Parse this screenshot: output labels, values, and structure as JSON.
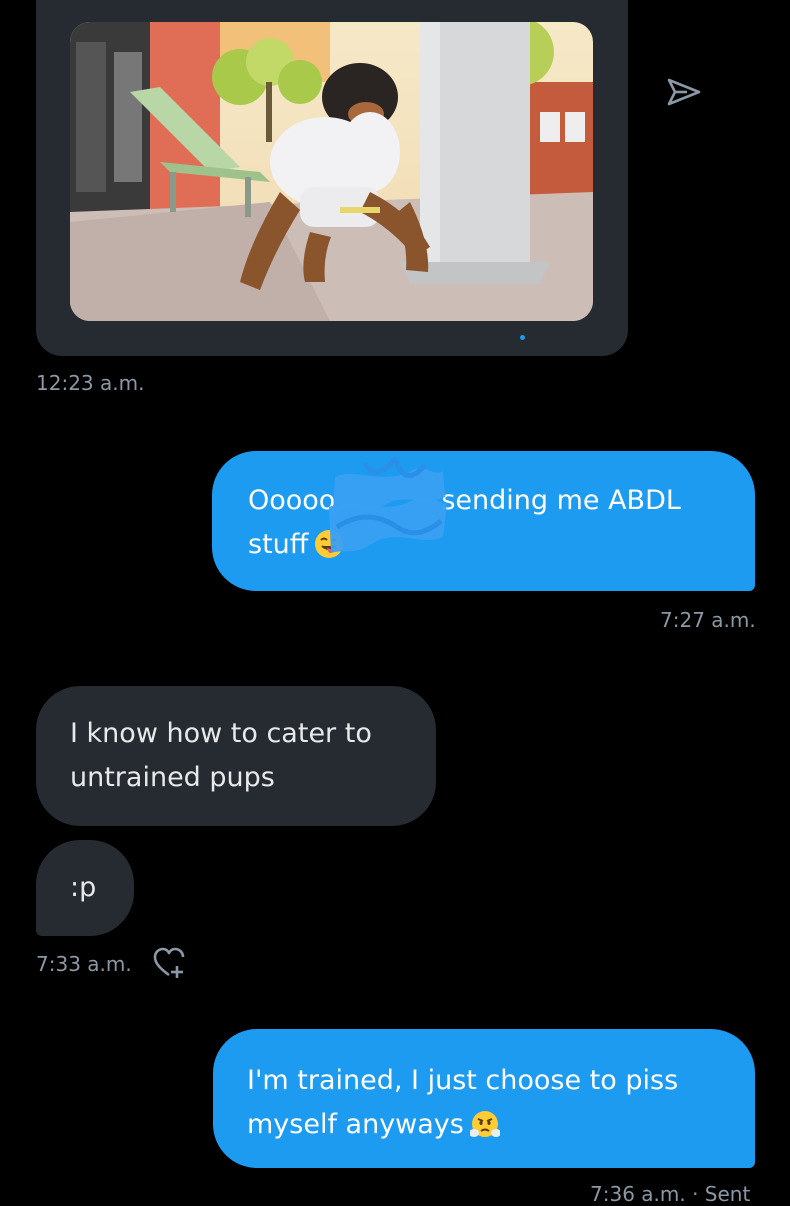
{
  "conversation": {
    "messages": [
      {
        "id": "m1",
        "direction": "received",
        "type": "image",
        "image_description": "cartoon rottweiler character crawling on sidewalk",
        "timestamp": "12:23 a.m."
      },
      {
        "id": "m2",
        "direction": "sent",
        "text_before_redaction": "Ooooo",
        "text_after_redaction": "sending me ABDL",
        "text_line2": "stuff",
        "emoji": "winking-face-with-tongue",
        "timestamp": "7:27 a.m."
      },
      {
        "id": "m3",
        "direction": "received",
        "text": "I know how to cater to untrained pups"
      },
      {
        "id": "m4",
        "direction": "received",
        "text": ":p",
        "timestamp": "7:33 a.m."
      },
      {
        "id": "m5",
        "direction": "sent",
        "text": "I'm trained, I just choose to piss myself anyways",
        "emoji": "face-with-steam-from-nose",
        "timestamp": "7:36 a.m. · Sent"
      }
    ]
  },
  "icons": {
    "share": "share-send-icon",
    "react": "heart-plus-icon"
  },
  "colors": {
    "background": "#000000",
    "sent_bubble": "#1d9bf0",
    "received_bubble": "#262b31",
    "timestamp": "#8b98a5",
    "redaction": "#3aa0f2"
  }
}
